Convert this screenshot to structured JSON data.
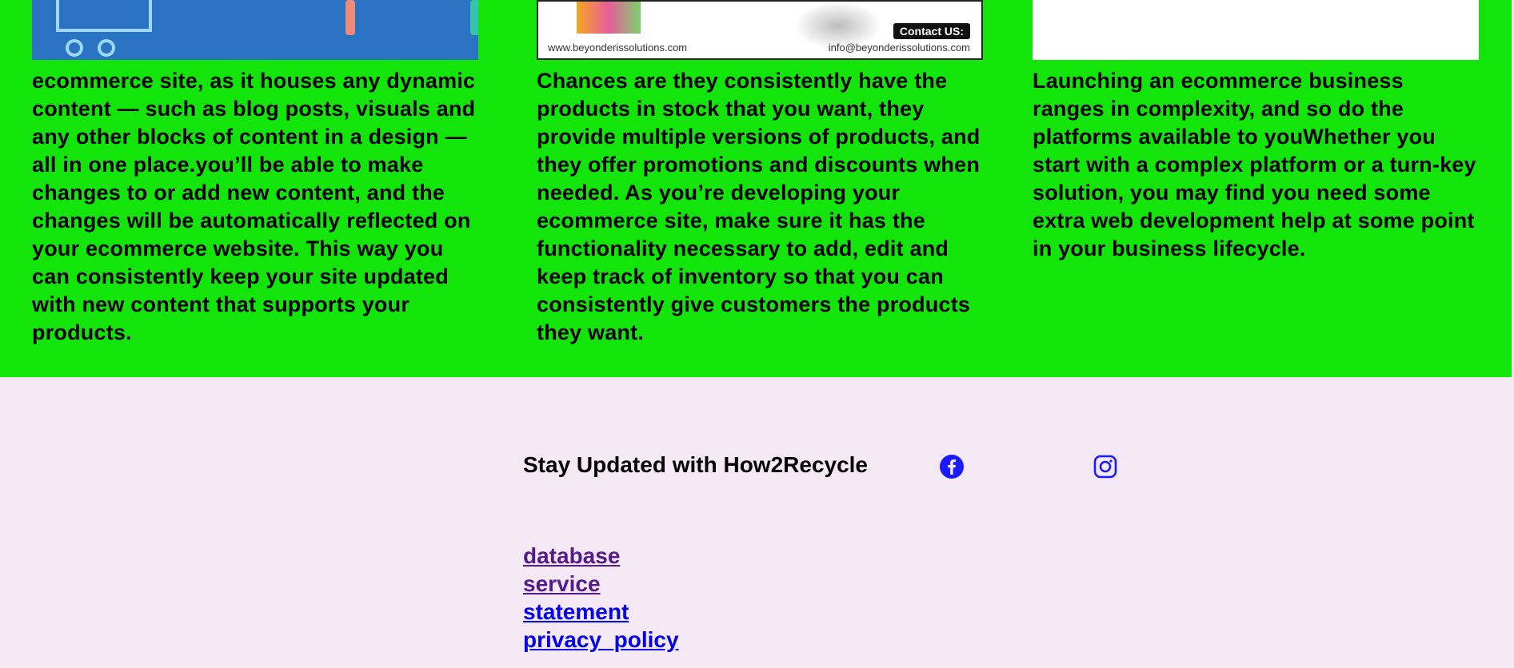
{
  "columns": [
    {
      "image_icon": "ecommerce-illustration",
      "text": "ecommerce site, as it houses any dynamic content — such as blog posts, visuals and any other blocks of content in a design — all in one place.you’ll be able to make changes to or add new content, and the changes will be automatically reflected on your ecommerce website. This way you can consistently keep your site updated with new content that supports your products."
    },
    {
      "image_icon": "beyonderis-banner",
      "banner": {
        "contact_label": "Contact US:",
        "website": "www.beyonderissolutions.com",
        "email": "info@beyonderissolutions.com"
      },
      "text": "Chances are they consistently have the products in stock that you want, they provide multiple versions of products, and they offer promotions and discounts when needed. As you’re developing your ecommerce site, make sure it has the functionality necessary to add, edit and keep track of inventory so that you can consistently give customers the products they want."
    },
    {
      "image_icon": "blank-image",
      "text": "Launching an ecommerce business ranges in complexity, and so do the platforms available to youWhether you start with a complex platform or a turn-key solution, you may find you need some extra web development help at some point in your business lifecycle."
    }
  ],
  "footer": {
    "title": "Stay Updated with How2Recycle",
    "social": [
      {
        "name": "facebook-icon"
      },
      {
        "name": "instagram-icon"
      }
    ],
    "links": [
      {
        "label": "database",
        "state": "visited"
      },
      {
        "label": "service",
        "state": "visited"
      },
      {
        "label": "statement",
        "state": "unvisited"
      },
      {
        "label": "privacy_policy",
        "state": "unvisited"
      }
    ]
  },
  "colors": {
    "band": "#13e40a",
    "footer_bg": "#f3e8f3",
    "link_visited": "#551a8b",
    "link_unvisited": "#0000ee",
    "social_icon": "#1a1aff"
  }
}
